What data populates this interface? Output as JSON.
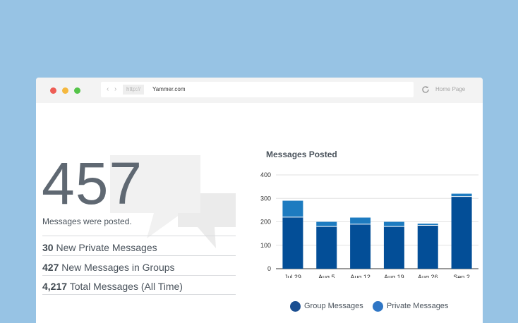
{
  "browser": {
    "protocol": "http://",
    "url": "Yammer.com",
    "home_label": "Home Page",
    "nav_back": "‹",
    "nav_forward": "›"
  },
  "stats": {
    "total": "457",
    "caption": "Messages were posted.",
    "lines": [
      {
        "value": "30",
        "label": "New Private Messages"
      },
      {
        "value": "427",
        "label": "New Messages in Groups"
      },
      {
        "value": "4,217",
        "label": "Total Messages (All Time)"
      }
    ]
  },
  "chart_data": {
    "type": "bar",
    "stacked": true,
    "title": "Messages Posted",
    "categories": [
      "Jul 29",
      "Aug 5",
      "Aug 12",
      "Aug 19",
      "Aug 26",
      "Sep 2"
    ],
    "series": [
      {
        "name": "Group Messages",
        "color": "#034e97",
        "values": [
          220,
          180,
          190,
          180,
          185,
          308
        ]
      },
      {
        "name": "Private Messages",
        "color": "#1d7bc0",
        "values": [
          70,
          20,
          28,
          20,
          7,
          12
        ]
      }
    ],
    "ylim": [
      0,
      400
    ],
    "yticks": [
      0,
      100,
      200,
      300,
      400
    ],
    "grid": true,
    "legend_position": "bottom"
  },
  "legend_colors": {
    "group": "#1b4f91",
    "private": "#2f76c5"
  },
  "icons": [
    "refresh-icon",
    "chat-bubbles-icon"
  ]
}
